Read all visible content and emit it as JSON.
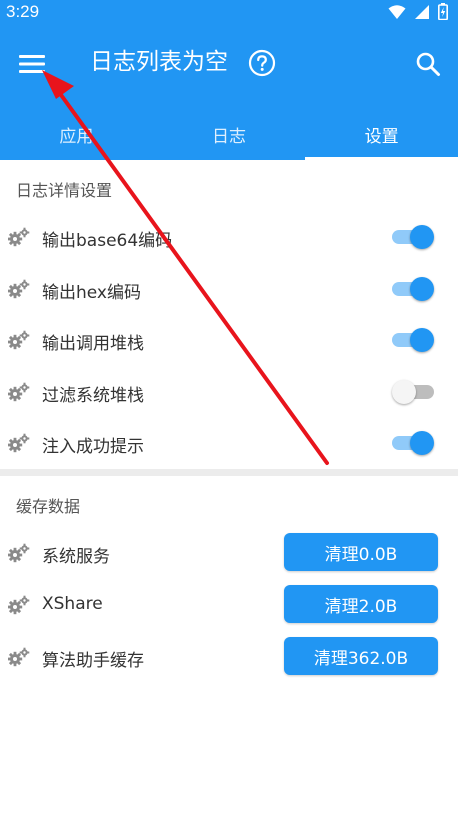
{
  "status_bar": {
    "time": "3:29"
  },
  "toolbar": {
    "title": "日志列表为空"
  },
  "tabs": [
    {
      "label": "应用",
      "active": false
    },
    {
      "label": "日志",
      "active": false
    },
    {
      "label": "设置",
      "active": true
    }
  ],
  "log_settings": {
    "header": "日志详情设置",
    "items": [
      {
        "label": "输出base64编码",
        "enabled": true
      },
      {
        "label": "输出hex编码",
        "enabled": true
      },
      {
        "label": "输出调用堆栈",
        "enabled": true
      },
      {
        "label": "过滤系统堆栈",
        "enabled": false
      },
      {
        "label": "注入成功提示",
        "enabled": true
      }
    ]
  },
  "cache_data": {
    "header": "缓存数据",
    "items": [
      {
        "label": "系统服务",
        "button": "清理0.0B"
      },
      {
        "label": "XShare",
        "button": "清理2.0B"
      },
      {
        "label": "算法助手缓存",
        "button": "清理362.0B"
      }
    ]
  },
  "colors": {
    "primary": "#2196f3",
    "switch_track_on": "#90caf9",
    "switch_track_off": "#bdbdbd",
    "annotation_arrow": "#e8141c"
  },
  "icons": {
    "menu": "hamburger-menu-icon",
    "help": "question-circle-icon",
    "search": "search-icon",
    "row": "gear-icon"
  }
}
